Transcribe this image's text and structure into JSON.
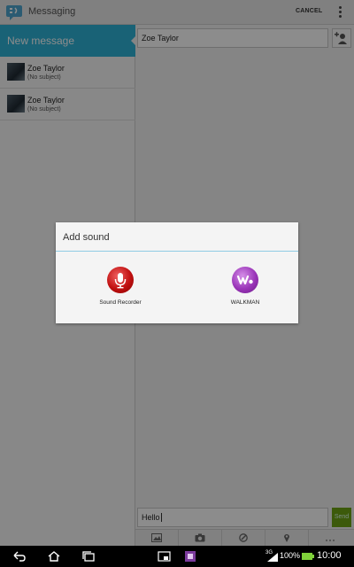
{
  "header": {
    "app_title": "Messaging",
    "cancel_label": "CANCEL"
  },
  "left_pane": {
    "new_message_label": "New message",
    "threads": [
      {
        "name": "Zoe Taylor",
        "subject": "(No subject)"
      },
      {
        "name": "Zoe Taylor",
        "subject": "(No subject)"
      }
    ]
  },
  "compose": {
    "recipient": "Zoe Taylor",
    "message_value": "Hello",
    "send_label": "Send"
  },
  "dialog": {
    "title": "Add sound",
    "options": [
      {
        "label": "Sound Recorder",
        "icon": "microphone-icon",
        "color": "#c01010"
      },
      {
        "label": "WALKMAN",
        "icon": "walkman-icon",
        "color": "#9a35b8"
      }
    ]
  },
  "attach_bar": {
    "icons": [
      "gallery-icon",
      "camera-icon",
      "sketch-icon",
      "location-icon",
      "more-icon"
    ]
  },
  "status_bar": {
    "network": "3G",
    "battery": "100%",
    "time": "10:00"
  },
  "colors": {
    "accent": "#2fb3d8",
    "send": "#6da414"
  }
}
